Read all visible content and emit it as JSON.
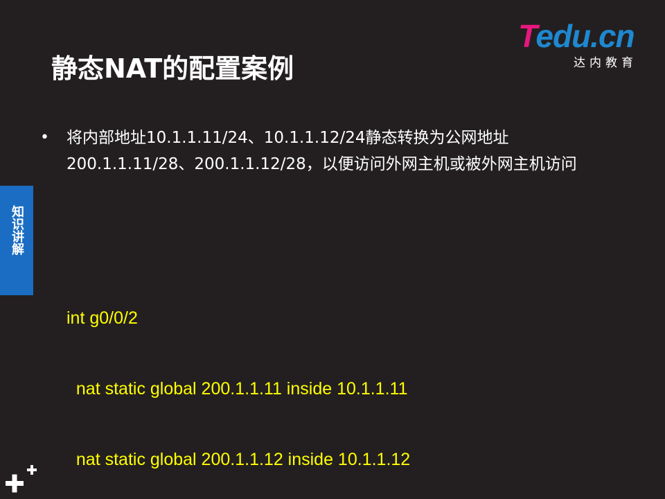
{
  "title": "静态NAT的配置案例",
  "logo": {
    "brand_t": "T",
    "brand_rest": "edu.cn",
    "subtitle": "达内教育",
    "colors": {
      "t": "#e6177e",
      "rest": "#1e88d0"
    }
  },
  "bullet": {
    "symbol": "•",
    "text": "将内部地址10.1.1.11/24、10.1.1.12/24静态转换为公网地址200.1.1.11/28、200.1.1.12/28，以便访问外网主机或被外网主机访问"
  },
  "side_tab": {
    "label": "知识讲解",
    "color": "#1a6dc2"
  },
  "code": {
    "lines": [
      "int g0/0/2",
      "  nat static global 200.1.1.11 inside 10.1.1.11",
      "  nat static global 200.1.1.12 inside 10.1.1.12"
    ],
    "color": "#ffff00"
  },
  "colors": {
    "background": "#231f20"
  },
  "icons": {
    "corner": "plus-icon"
  }
}
